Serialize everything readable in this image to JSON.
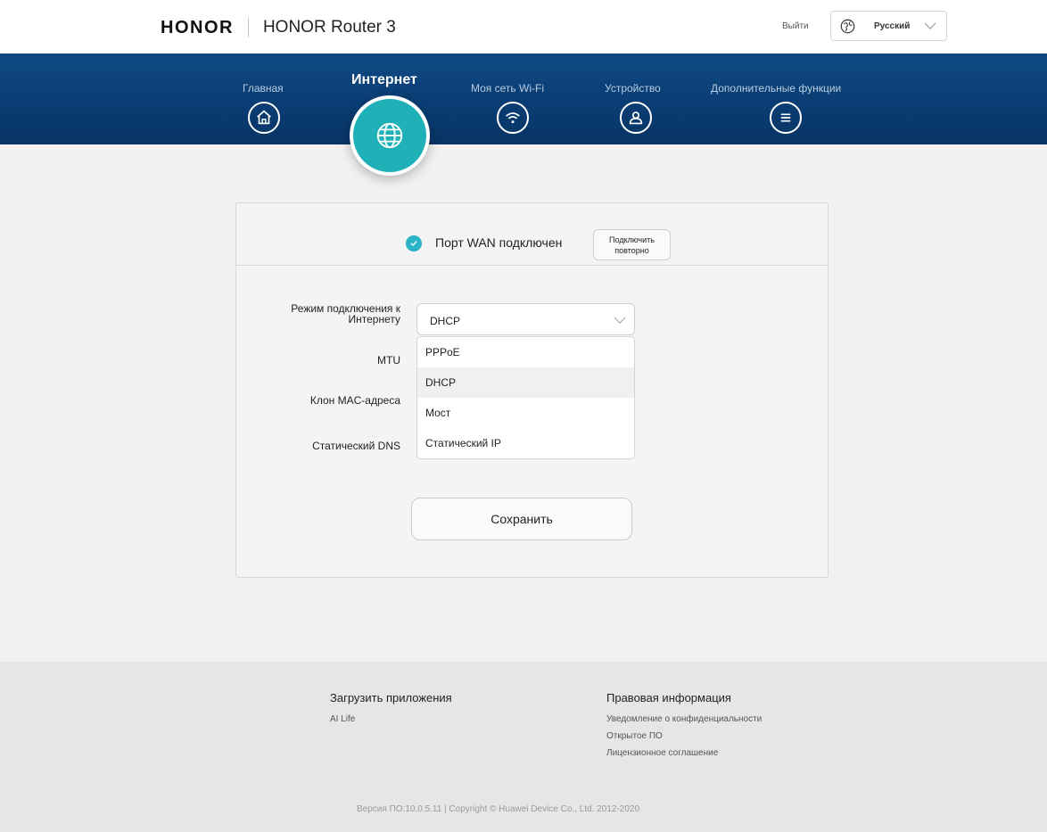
{
  "header": {
    "brand": "HONOR",
    "model": "HONOR Router 3",
    "logout_label": "Выйти",
    "language": "Русский"
  },
  "nav": {
    "items": [
      {
        "label": "Главная",
        "icon": "home-icon"
      },
      {
        "label": "Интернет",
        "icon": "globe-icon",
        "active": true
      },
      {
        "label": "Моя сеть Wi-Fi",
        "icon": "wifi-icon"
      },
      {
        "label": "Устройство",
        "icon": "user-icon"
      },
      {
        "label": "Дополнительные функции",
        "icon": "menu-icon"
      }
    ]
  },
  "status": {
    "text": "Порт WAN подключен",
    "reconnect_label_line1": "Подключить",
    "reconnect_label_line2": "повторно"
  },
  "form": {
    "mode_label_line1": "Режим подключения к",
    "mode_label_line2": "Интернету",
    "mode_value": "DHCP",
    "mtu_label": "MTU",
    "mac_clone_label": "Клон MAC-адреса",
    "static_dns_label": "Статический DNS",
    "options": [
      "PPPoE",
      "DHCP",
      "Мост",
      "Статический IP"
    ],
    "selected_option": "DHCP",
    "save_label": "Сохранить"
  },
  "footer": {
    "apps_heading": "Загрузить приложения",
    "apps_link": "AI Life",
    "legal_heading": "Правовая информация",
    "legal_links": [
      "Уведомление о конфиденциальности",
      "Открытое ПО",
      "Лицензионное соглашение"
    ],
    "copyright": "Версия ПО:10.0.5.11 | Copyright © Huawei Device Co., Ltd. 2012-2020"
  },
  "colors": {
    "nav_bg": "#0a3d73",
    "accent_teal": "#1fb1b8",
    "check_blue": "#2db3c7"
  }
}
